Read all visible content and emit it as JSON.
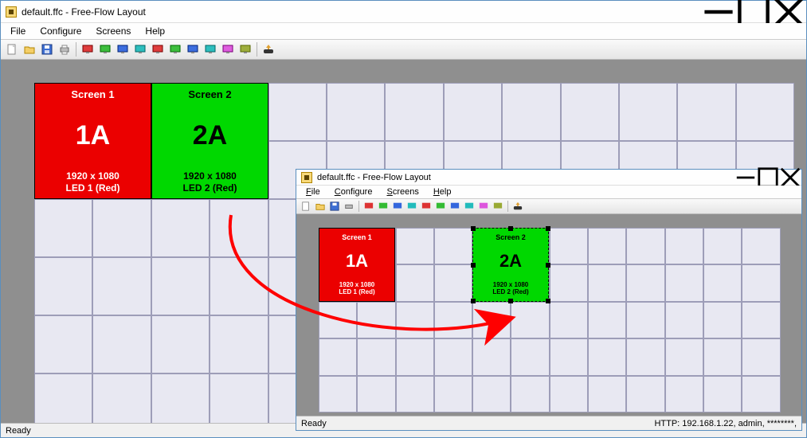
{
  "window1": {
    "title": "default.ffc - Free-Flow Layout",
    "menus": {
      "file": "File",
      "configure": "Configure",
      "screens": "Screens",
      "help": "Help"
    },
    "status": "Ready",
    "screen1": {
      "name": "Screen 1",
      "label": "1A",
      "res": "1920 x 1080",
      "led": "LED 1 (Red)"
    },
    "screen2": {
      "name": "Screen 2",
      "label": "2A",
      "res": "1920 x 1080",
      "led": "LED 2 (Red)"
    }
  },
  "window2": {
    "title": "default.ffc - Free-Flow Layout",
    "menus": {
      "file": "File",
      "configure": "Configure",
      "screens": "Screens",
      "help": "Help"
    },
    "status_left": "Ready",
    "status_right": "HTTP: 192.168.1.22, admin, ********,",
    "screen1": {
      "name": "Screen 1",
      "label": "1A",
      "res": "1920 x 1080",
      "led": "LED 1 (Red)"
    },
    "screen2": {
      "name": "Screen 2",
      "label": "2A",
      "res": "1920 x 1080",
      "led": "LED 2 (Red)"
    }
  },
  "toolbar_icons": [
    "new",
    "open",
    "save",
    "print",
    "mon-red",
    "mon-green",
    "mon-blue",
    "mon-teal",
    "mon-red2",
    "mon-green2",
    "mon-blue2",
    "mon-teal2",
    "mon-pink",
    "mon-olive",
    "send"
  ],
  "colors": {
    "red": "#eb0000",
    "green": "#00d800"
  }
}
